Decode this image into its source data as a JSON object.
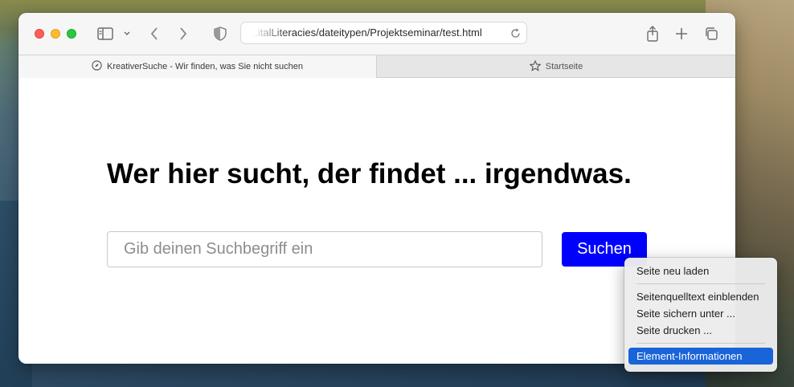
{
  "browser": {
    "url": "...italLiteracies/dateitypen/Projektseminar/test.html",
    "tabs": [
      {
        "label": "KreativerSuche - Wir finden, was Sie nicht suchen",
        "icon": "compass-icon",
        "active": true
      },
      {
        "label": "Startseite",
        "icon": "star-icon",
        "active": false
      }
    ]
  },
  "page": {
    "headline": "Wer hier sucht, der findet ... irgendwas.",
    "search_placeholder": "Gib deinen Suchbegriff ein",
    "search_value": "",
    "search_button": "Suchen",
    "accent_color": "#0000ff"
  },
  "context_menu": {
    "groups": [
      [
        "Seite neu laden"
      ],
      [
        "Seitenquelltext einblenden",
        "Seite sichern unter ...",
        "Seite drucken ..."
      ],
      [
        "Element-Informationen"
      ]
    ],
    "highlighted": "Element-Informationen",
    "highlight_color": "#1964d8"
  }
}
